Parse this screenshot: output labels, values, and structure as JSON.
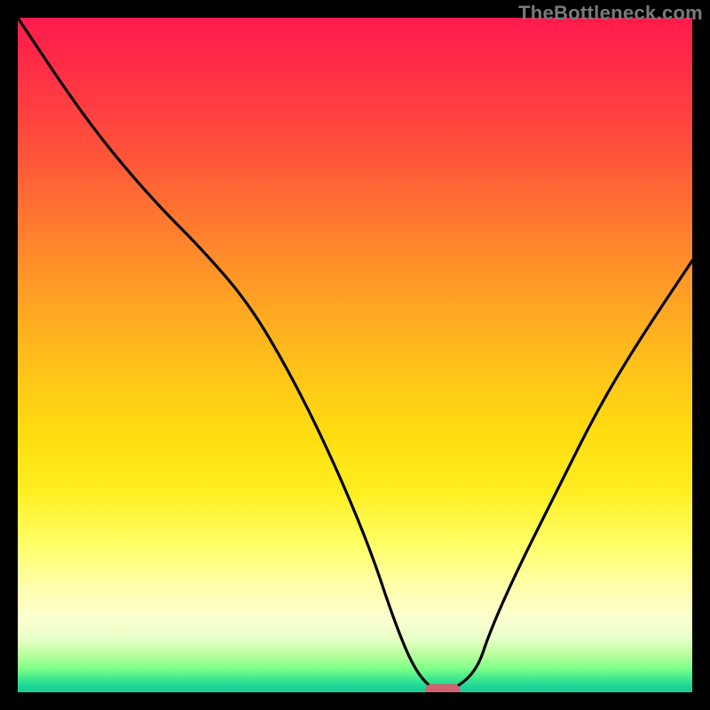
{
  "watermark": "TheBottleneck.com",
  "chart_data": {
    "type": "line",
    "title": "",
    "xlabel": "",
    "ylabel": "",
    "xlim": [
      0,
      100
    ],
    "ylim": [
      0,
      100
    ],
    "series": [
      {
        "name": "bottleneck-curve",
        "x": [
          0,
          8,
          14,
          21,
          27,
          34,
          40,
          46,
          52,
          56,
          59,
          62,
          64,
          68,
          70,
          74,
          80,
          86,
          92,
          100
        ],
        "values": [
          100,
          88,
          80,
          72,
          66,
          58,
          48,
          36,
          22,
          10,
          3,
          0,
          0,
          3,
          9,
          18,
          30,
          42,
          52,
          64
        ]
      }
    ],
    "marker": {
      "name": "optimal-point",
      "x": 63,
      "y": 0,
      "color": "#d0646e",
      "width_pct": 5.2,
      "height_pct": 1.9
    },
    "gradient_stops": [
      {
        "pos": 0,
        "color": "#ff1a4d"
      },
      {
        "pos": 50,
        "color": "#ffc020"
      },
      {
        "pos": 80,
        "color": "#ffff80"
      },
      {
        "pos": 100,
        "color": "#18cc96"
      }
    ]
  }
}
